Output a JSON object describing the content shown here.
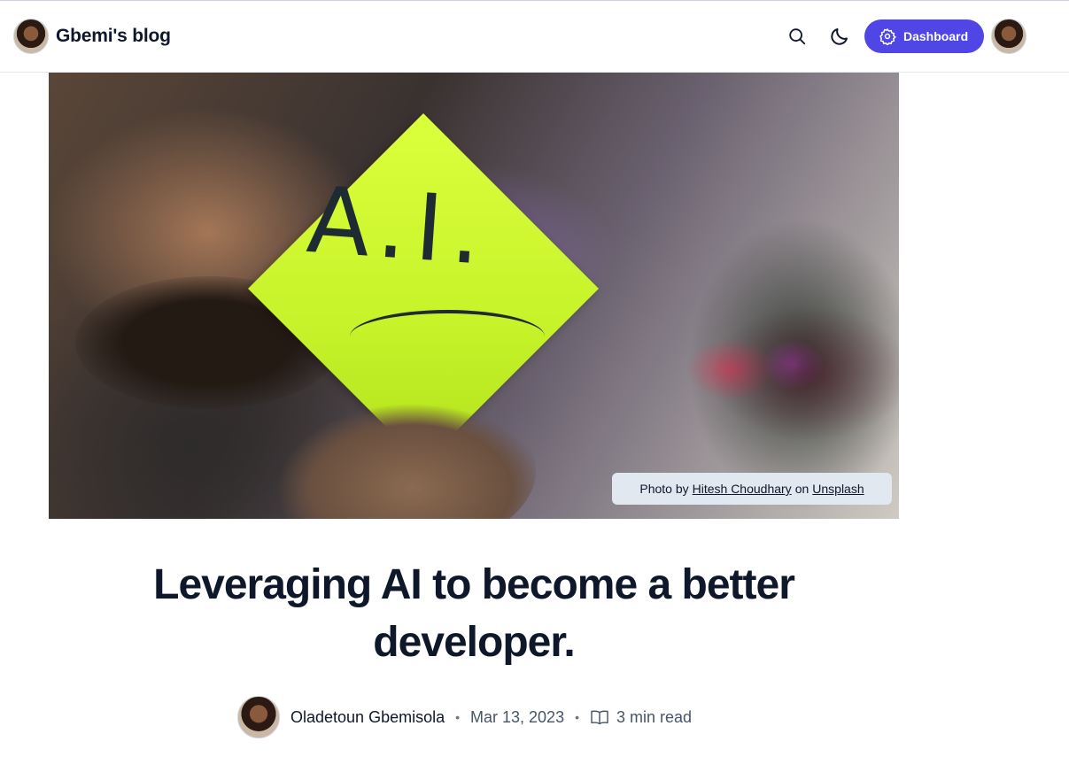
{
  "header": {
    "blog_title": "Gbemi's blog",
    "dashboard_label": "Dashboard",
    "accent_color": "#4f46e5",
    "icons": [
      "search-icon",
      "moon-icon",
      "gear-icon"
    ]
  },
  "cover": {
    "note_text": "A.I.",
    "caption": {
      "prefix": "Photo by",
      "photographer": "Hitesh Choudhary",
      "middle": "on",
      "source": "Unsplash"
    }
  },
  "post": {
    "title": "Leveraging AI to become a better developer.",
    "author": "Oladetoun Gbemisola",
    "date": "Mar 13, 2023",
    "read_time": "3 min read"
  }
}
